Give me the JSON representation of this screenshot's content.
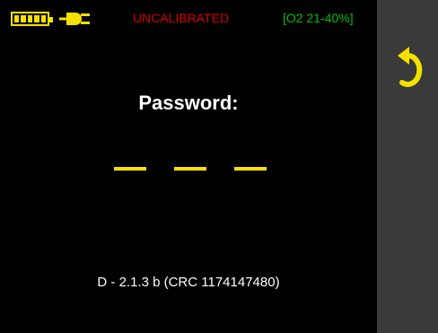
{
  "status_bar": {
    "calibration_status": "UNCALIBRATED",
    "o2_range": "[O2 21-40%]",
    "battery_icon": "battery-full-icon",
    "power_icon": "power-plug-icon"
  },
  "sidebar": {
    "back_icon": "back-arrow-icon"
  },
  "main": {
    "title": "Password:",
    "password_digits": [
      "_",
      "_",
      "_"
    ],
    "version": "D - 2.1.3 b (CRC 1174147480)"
  },
  "colors": {
    "accent": "#f5e000",
    "warning": "#d70000",
    "ok": "#00c000",
    "sidebar": "#3a3a3a"
  }
}
